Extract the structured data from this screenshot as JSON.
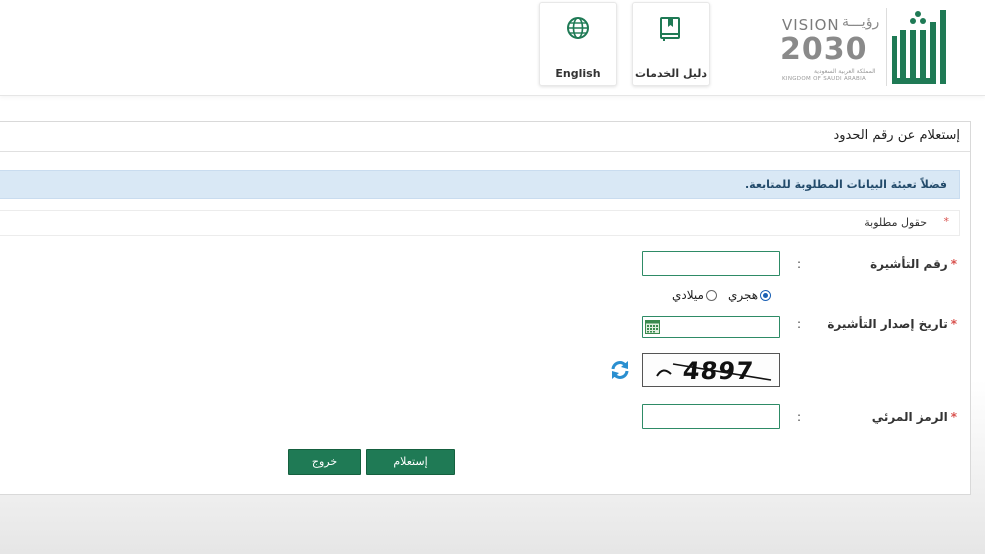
{
  "header": {
    "vision": {
      "title": "VISION",
      "arabic_title": "رؤيـــة",
      "year": "2030",
      "arabic_kingdom": "المملكة العربية السعودية",
      "english_kingdom": "KINGDOM OF SAUDI ARABIA"
    },
    "services_guide_label": "دليل الخدمات",
    "english_label": "English",
    "brand_color": "#1f7a55"
  },
  "panel": {
    "title": "إستعلام عن رقم الحدود",
    "info_message": "فضلاً تعبئة البيانات المطلوبة للمتابعة.",
    "required_note": "حقول مطلوبة",
    "required_star": "*"
  },
  "form": {
    "visa_number": {
      "label": "رقم التأشيرة",
      "value": ""
    },
    "calendar_options": [
      {
        "label": "هجري",
        "selected": true
      },
      {
        "label": "ميلادي",
        "selected": false
      }
    ],
    "issue_date": {
      "label": "تاريخ إصدار التأشيرة",
      "value": ""
    },
    "captcha_text": "4897",
    "verification_code": {
      "label": "الرمز المرئي",
      "value": ""
    },
    "colon": ":",
    "inquiry_button": "إستعلام",
    "exit_button": "خروج"
  }
}
